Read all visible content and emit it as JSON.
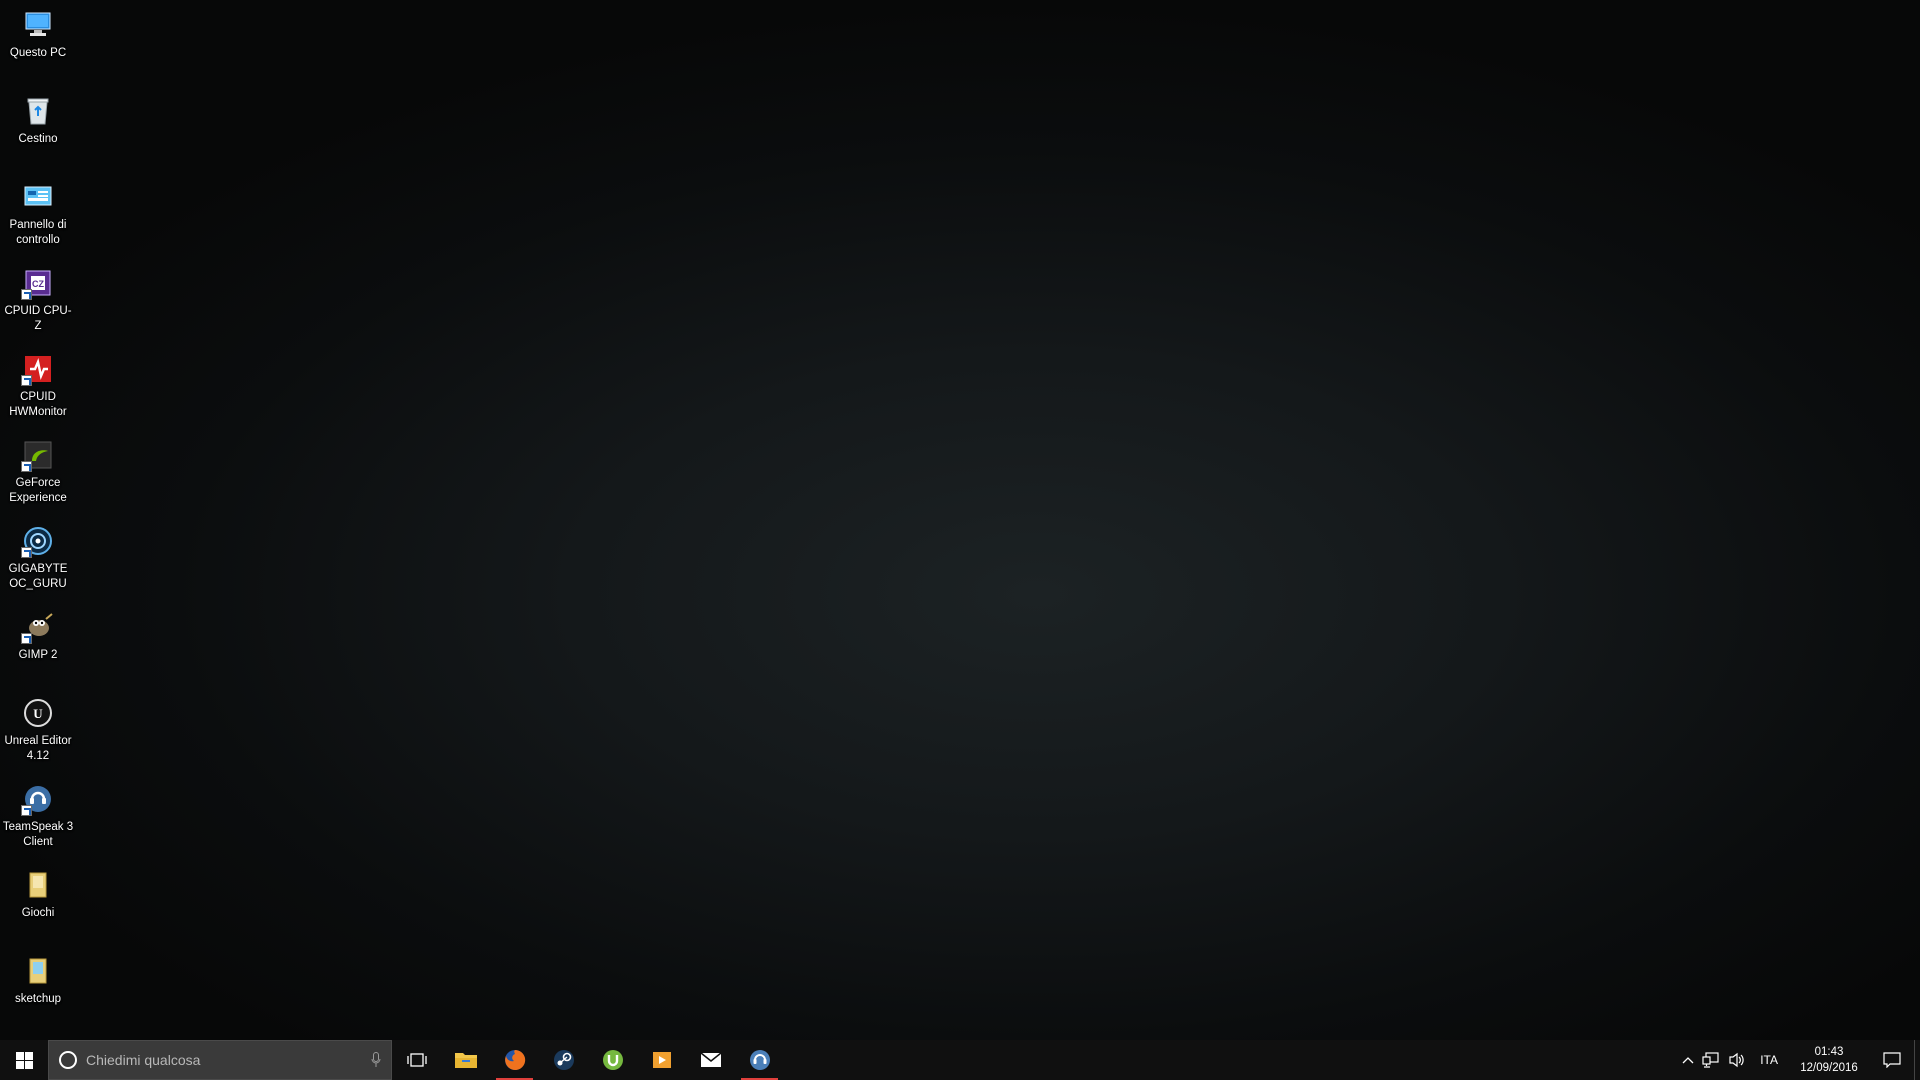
{
  "desktop": {
    "icons": [
      {
        "label": "Questo PC",
        "icon": "this-pc-icon"
      },
      {
        "label": "Cestino",
        "icon": "recycle-bin-icon"
      },
      {
        "label": "Pannello di\ncontrollo",
        "icon": "control-panel-icon"
      },
      {
        "label": "CPUID CPU-Z",
        "icon": "cpuz-icon"
      },
      {
        "label": "CPUID\nHWMonitor",
        "icon": "hwmonitor-icon"
      },
      {
        "label": "GeForce\nExperience",
        "icon": "geforce-icon"
      },
      {
        "label": "GIGABYTE\nOC_GURU",
        "icon": "gigabyte-icon"
      },
      {
        "label": "GIMP 2",
        "icon": "gimp-icon"
      },
      {
        "label": "Unreal Editor\n4.12",
        "icon": "unreal-icon"
      },
      {
        "label": "TeamSpeak 3\nClient",
        "icon": "teamspeak-icon"
      },
      {
        "label": "Giochi",
        "icon": "folder-icon"
      },
      {
        "label": "sketchup",
        "icon": "folder-icon"
      }
    ]
  },
  "taskbar": {
    "search_placeholder": "Chiedimi qualcosa",
    "pinned": [
      {
        "name": "task-view",
        "icon": "task-view-icon",
        "running": false
      },
      {
        "name": "file-explorer",
        "icon": "folder-icon",
        "running": false
      },
      {
        "name": "firefox",
        "icon": "firefox-icon",
        "running": true
      },
      {
        "name": "steam",
        "icon": "steam-icon",
        "running": false
      },
      {
        "name": "utorrent",
        "icon": "utorrent-icon",
        "running": false
      },
      {
        "name": "media-player",
        "icon": "media-player-icon",
        "running": false
      },
      {
        "name": "mail",
        "icon": "mail-icon",
        "running": false
      },
      {
        "name": "teamspeak",
        "icon": "teamspeak-icon",
        "running": true
      }
    ],
    "tray": {
      "language": "ITA",
      "time": "01:43",
      "date": "12/09/2016"
    }
  },
  "colors": {
    "taskbar_bg": "#101010",
    "search_bg": "#3a3a3a",
    "running_indicator": "#e0403c",
    "accent_blue": "#1e88e5"
  }
}
